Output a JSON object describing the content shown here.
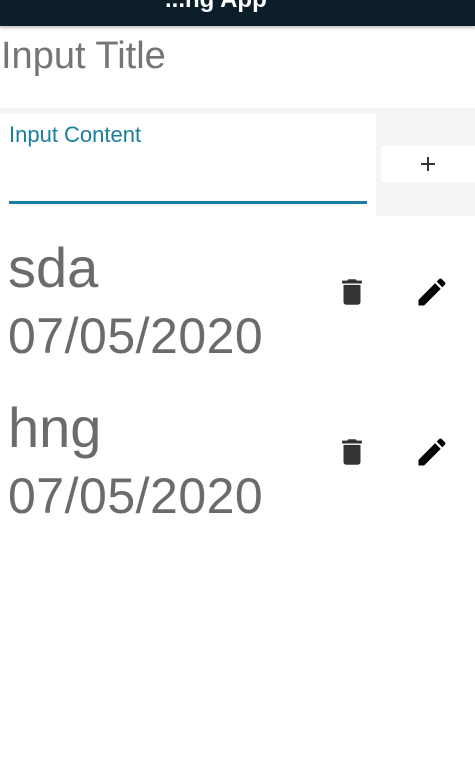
{
  "app": {
    "title": "...ng App"
  },
  "form": {
    "title_placeholder": "Input Title",
    "title_value": "",
    "content_label": "Input Content",
    "content_value": ""
  },
  "icons": {
    "add": "plus-icon",
    "delete": "trash-icon",
    "edit": "pencil-icon"
  },
  "colors": {
    "topbar": "#0b1e2a",
    "accent": "#1a7f9e",
    "text_muted": "#6b6b6b",
    "icon": "#333333"
  },
  "notes": [
    {
      "title": "sda",
      "date": "07/05/2020"
    },
    {
      "title": "hng",
      "date": "07/05/2020"
    }
  ]
}
